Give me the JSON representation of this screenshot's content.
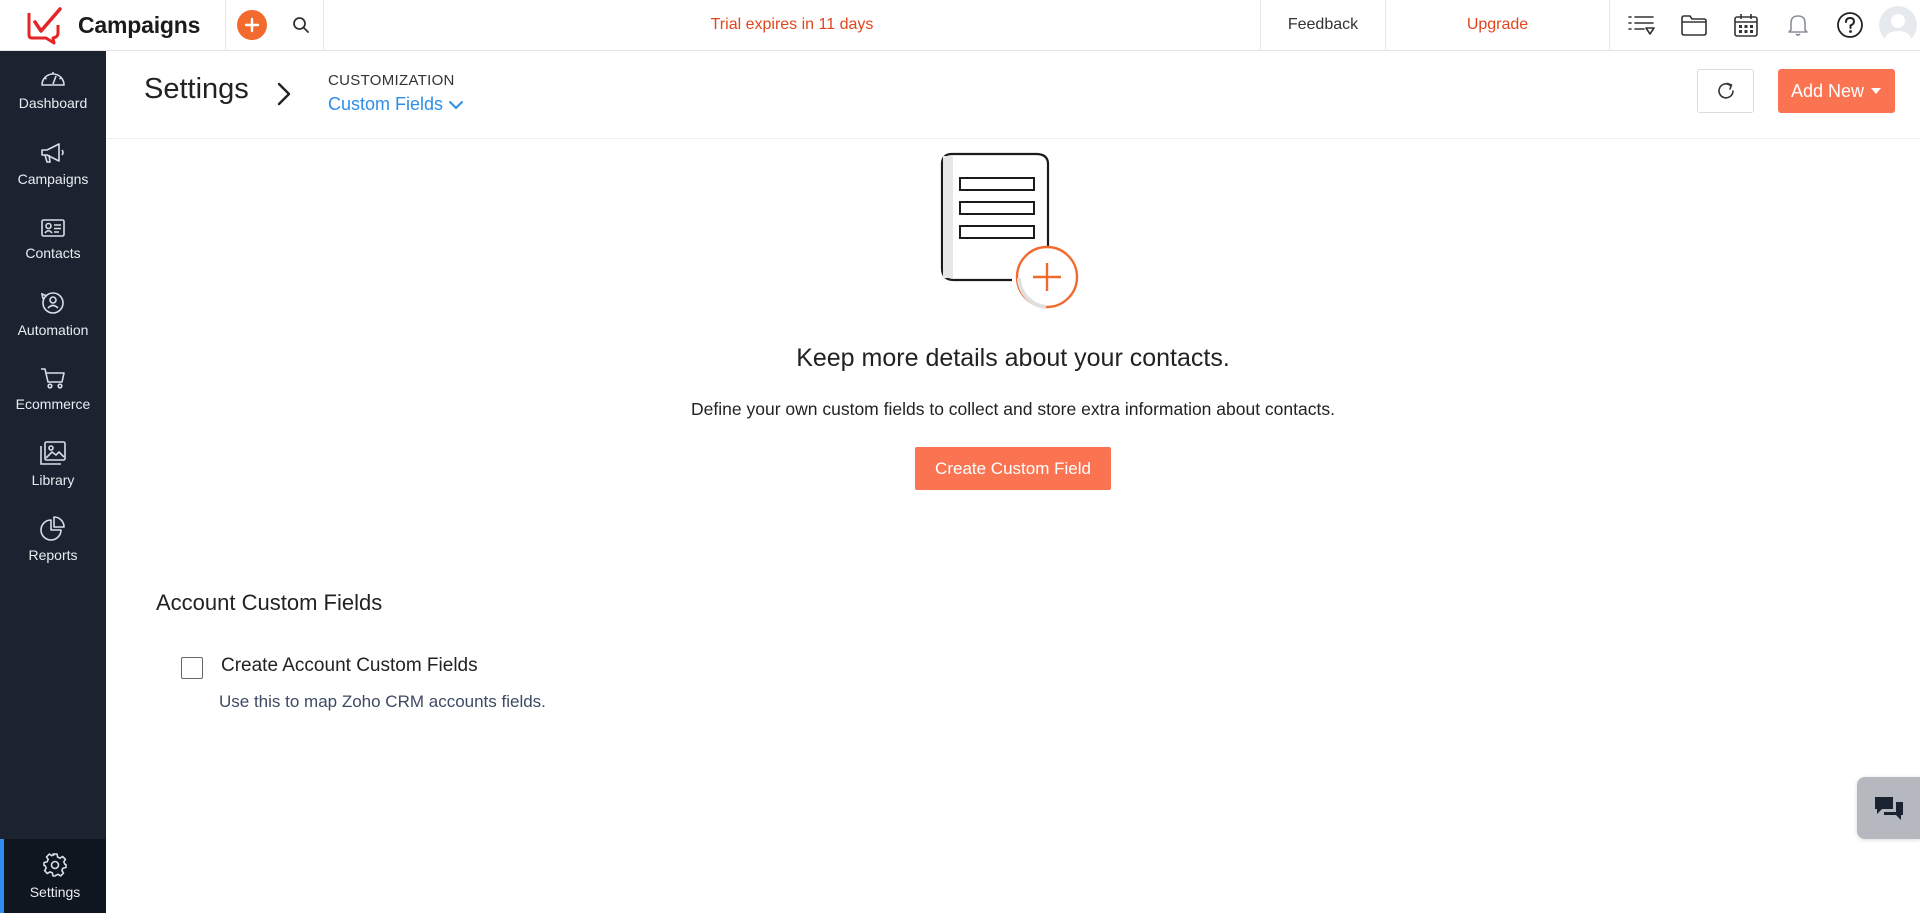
{
  "app": {
    "name": "Campaigns",
    "accent": "#fb7452",
    "link_color": "#2d8fe6"
  },
  "topbar": {
    "trial_text": "Trial expires in 11 days",
    "feedback_label": "Feedback",
    "upgrade_label": "Upgrade",
    "icons": [
      "list-icon",
      "folder-icon",
      "calendar-icon",
      "bell-icon",
      "help-icon",
      "avatar"
    ]
  },
  "sidebar": {
    "items": [
      {
        "label": "Dashboard",
        "icon": "speedometer-icon"
      },
      {
        "label": "Campaigns",
        "icon": "megaphone-icon"
      },
      {
        "label": "Contacts",
        "icon": "contact-card-icon"
      },
      {
        "label": "Automation",
        "icon": "automation-icon"
      },
      {
        "label": "Ecommerce",
        "icon": "cart-icon"
      },
      {
        "label": "Library",
        "icon": "image-icon"
      },
      {
        "label": "Reports",
        "icon": "pie-chart-icon"
      }
    ],
    "settings": {
      "label": "Settings",
      "icon": "gear-icon",
      "active": true
    }
  },
  "subheader": {
    "title": "Settings",
    "section": "CUSTOMIZATION",
    "current": "Custom Fields",
    "add_new_label": "Add New"
  },
  "empty_state": {
    "heading": "Keep more details about your contacts.",
    "description": "Define your own custom fields to collect and store extra information about contacts.",
    "button_label": "Create Custom Field"
  },
  "account_custom_fields": {
    "title": "Account Custom Fields",
    "checkbox_label": "Create Account Custom Fields",
    "checked": false,
    "help_text": "Use this to map Zoho CRM accounts fields."
  }
}
